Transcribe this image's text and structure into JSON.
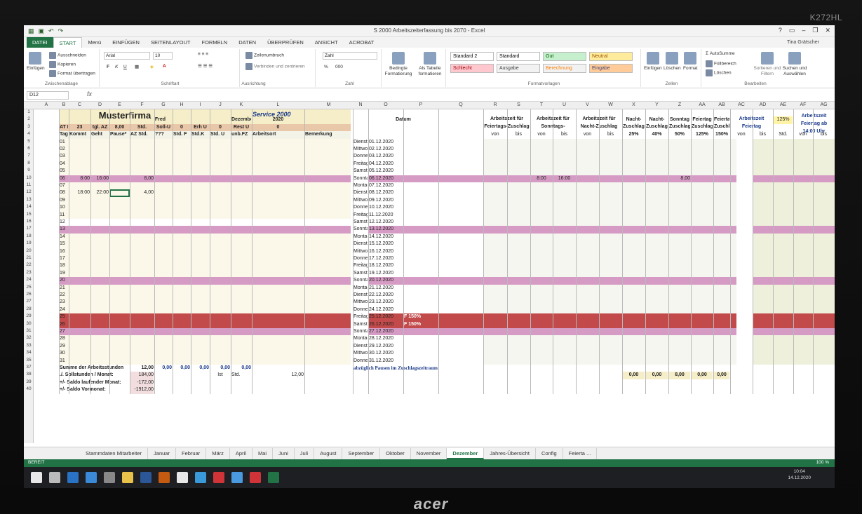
{
  "monitor": {
    "id_label": "K272HL",
    "brand": "acer"
  },
  "window": {
    "title": "S 2000 Arbeitszeiterfassung bis 2070 - Excel",
    "user": "Tina Grätscher"
  },
  "ribbon_tabs": [
    "DATEI",
    "START",
    "Menü",
    "EINFÜGEN",
    "SEITENLAYOUT",
    "FORMELN",
    "DATEN",
    "ÜBERPRÜFEN",
    "ANSICHT",
    "ACROBAT"
  ],
  "ribbon": {
    "clipboard": {
      "label": "Zwischenablage",
      "paste": "Einfügen",
      "cut": "Ausschneiden",
      "copy": "Kopieren",
      "format": "Format übertragen"
    },
    "font": {
      "label": "Schriftart",
      "name": "Arial",
      "size": "10",
      "bold": "F",
      "italic": "K",
      "underline": "U"
    },
    "alignment": {
      "label": "Ausrichtung",
      "wrap": "Zeilenumbruch",
      "merge": "Verbinden und zentrieren"
    },
    "number": {
      "label": "Zahl",
      "format": "Zahl",
      "percent": "%",
      "thousands": "000"
    },
    "cond": "Bedingte Formatierung",
    "astable": "Als Tabelle formatieren",
    "styles": {
      "label": "Formatvorlagen",
      "items": [
        {
          "name": "Standard 2",
          "bg": "#ffffff",
          "fg": "#000000"
        },
        {
          "name": "Standard",
          "bg": "#ffffff",
          "fg": "#000000"
        },
        {
          "name": "Gut",
          "bg": "#c6efce",
          "fg": "#006100"
        },
        {
          "name": "Neutral",
          "bg": "#ffeb9c",
          "fg": "#9c5700"
        },
        {
          "name": "Schlecht",
          "bg": "#ffc7ce",
          "fg": "#9c0006"
        },
        {
          "name": "Ausgabe",
          "bg": "#f2f2f2",
          "fg": "#3f3f3f"
        },
        {
          "name": "Berechnung",
          "bg": "#f2f2f2",
          "fg": "#fa7d00"
        },
        {
          "name": "Eingabe",
          "bg": "#ffcc99",
          "fg": "#3f3f76"
        }
      ]
    },
    "cells": {
      "label": "Zellen",
      "insert": "Einfügen",
      "delete": "Löschen",
      "format": "Format"
    },
    "editing": {
      "label": "Bearbeiten",
      "autosum": "AutoSumme",
      "fill": "Füllbereich",
      "clear": "Löschen",
      "sort": "Sortieren und Filtern",
      "find": "Suchen und Auswählen"
    }
  },
  "namebox": "D12",
  "fx": "fx",
  "columns": [
    "A",
    "B",
    "C",
    "D",
    "E",
    "F",
    "G",
    "H",
    "I",
    "J",
    "K",
    "L",
    "M",
    "N",
    "O",
    "P",
    "Q",
    "R",
    "S",
    "T",
    "U",
    "V",
    "W",
    "X",
    "Y",
    "Z",
    "AA",
    "AB",
    "AC",
    "AD",
    "AE",
    "AF",
    "AG"
  ],
  "left": {
    "company": "Musterfirma",
    "logo": "Service 2000",
    "name": "Fred",
    "month": "Dezember",
    "year": "2020",
    "r3": [
      "AT Monat",
      "23",
      "tgl. AZ",
      "8,00",
      "Std.",
      "Soll-U",
      "0",
      "Erh U",
      "0",
      "Rest U",
      "0"
    ],
    "r4": [
      "Tag",
      "Kommt",
      "Geht",
      "Pause*",
      "AZ Std.",
      "???",
      "Std. F",
      "Std.K",
      "Std. U",
      "unb.FZ",
      "Arbeitsort",
      "Bemerkung"
    ],
    "days": [
      "01",
      "02",
      "03",
      "04",
      "05",
      "06",
      "07",
      "08",
      "09",
      "10",
      "11",
      "12",
      "13",
      "14",
      "15",
      "16",
      "17",
      "18",
      "19",
      "20",
      "21",
      "22",
      "23",
      "24",
      "25",
      "26",
      "27",
      "28",
      "29",
      "30",
      "31"
    ],
    "entries": [
      {
        "day": "06",
        "kommt": "8:00",
        "geht": "16:00",
        "az": "8,00"
      },
      {
        "day": "08",
        "kommt": "18:00",
        "geht": "22:00",
        "az": "4,00"
      }
    ],
    "sum_label": "Summe der Arbeitsstunden",
    "sum_values": [
      "12,00",
      "0,00",
      "0,00",
      "0,00",
      "0,00",
      "0,00"
    ],
    "soll_label": "./. Sollstunden / Monat:",
    "soll_value": "184,00",
    "saldo_label": "+/- Saldo laufender Monat:",
    "saldo_value": "-172,00",
    "vormonat_label": "+/- Saldo Vormonat:",
    "vormonat_value": "-1912,00",
    "ist_label": "Ist",
    "std_label": "Std.",
    "ist_value": "12,00"
  },
  "right": {
    "datum": "Datum",
    "group_headers": [
      "Arbeitszeit für Feiertags-Zuschlag",
      "Arbeitszeit für Sonntags-Zuschlag",
      "Arbeitszeit für Nacht-Zuschlag"
    ],
    "zuschlag_headers": [
      "Nacht-Zuschlag",
      "Nacht-Zuschlag",
      "Sonntag Zuschlag",
      "Feiertag Zuschlag",
      "Feiertag Zuschlag"
    ],
    "von": "von",
    "bis": "bis",
    "pcts": [
      "25%",
      "40%",
      "50%",
      "125%",
      "150%"
    ],
    "rows": [
      [
        "Dienstag",
        "01.12.2020"
      ],
      [
        "Mittwoch",
        "02.12.2020"
      ],
      [
        "Donnerstag",
        "03.12.2020"
      ],
      [
        "Freitag",
        "04.12.2020"
      ],
      [
        "Samstag",
        "05.12.2020"
      ],
      [
        "Sonntag",
        "06.12.2020"
      ],
      [
        "Montag",
        "07.12.2020"
      ],
      [
        "Dienstag",
        "08.12.2020"
      ],
      [
        "Mittwoch",
        "09.12.2020"
      ],
      [
        "Donnerstag",
        "10.12.2020"
      ],
      [
        "Freitag",
        "11.12.2020"
      ],
      [
        "Samstag",
        "12.12.2020"
      ],
      [
        "Sonntag",
        "13.12.2020"
      ],
      [
        "Montag",
        "14.12.2020"
      ],
      [
        "Dienstag",
        "15.12.2020"
      ],
      [
        "Mittwoch",
        "16.12.2020"
      ],
      [
        "Donnerstag",
        "17.12.2020"
      ],
      [
        "Freitag",
        "18.12.2020"
      ],
      [
        "Samstag",
        "19.12.2020"
      ],
      [
        "Sonntag",
        "20.12.2020"
      ],
      [
        "Montag",
        "21.12.2020"
      ],
      [
        "Dienstag",
        "22.12.2020"
      ],
      [
        "Mittwoch",
        "23.12.2020"
      ],
      [
        "Donnerstag",
        "24.12.2020"
      ],
      [
        "Freitag",
        "25.12.2020"
      ],
      [
        "Samstag",
        "26.12.2020"
      ],
      [
        "Sonntag",
        "27.12.2020"
      ],
      [
        "Montag",
        "28.12.2020"
      ],
      [
        "Dienstag",
        "29.12.2020"
      ],
      [
        "Mittwoch",
        "30.12.2020"
      ],
      [
        "Donnerstag",
        "31.12.2020"
      ]
    ],
    "feiertag_note": "F 150%",
    "sunday6": {
      "von": "8:00",
      "bis": "16:00",
      "sonntag": "8,00"
    },
    "abzug": "abzüglich Pausen im Zuschlagszeitraum",
    "totals": [
      "0,00",
      "0,00",
      "8,00",
      "0,00",
      "0,00"
    ]
  },
  "far": {
    "feiertag": "Arbeitszeit Feiertag",
    "pct": "125%",
    "ab14": "Arbeitszeit Feiertag ab 14:00 Uhr",
    "von": "von",
    "bis": "bis",
    "std": "Std."
  },
  "sheet_tabs": [
    "Stammdaten Mitarbeiter",
    "Januar",
    "Februar",
    "März",
    "April",
    "Mai",
    "Juni",
    "Juli",
    "August",
    "September",
    "Oktober",
    "November",
    "Dezember",
    "Jahres-Übersicht",
    "Config",
    "Feierta ..."
  ],
  "active_tab": "Dezember",
  "status": {
    "ready": "BEREIT",
    "zoom": "100 %"
  },
  "clock": {
    "time": "10:04",
    "date": "14.12.2020"
  }
}
